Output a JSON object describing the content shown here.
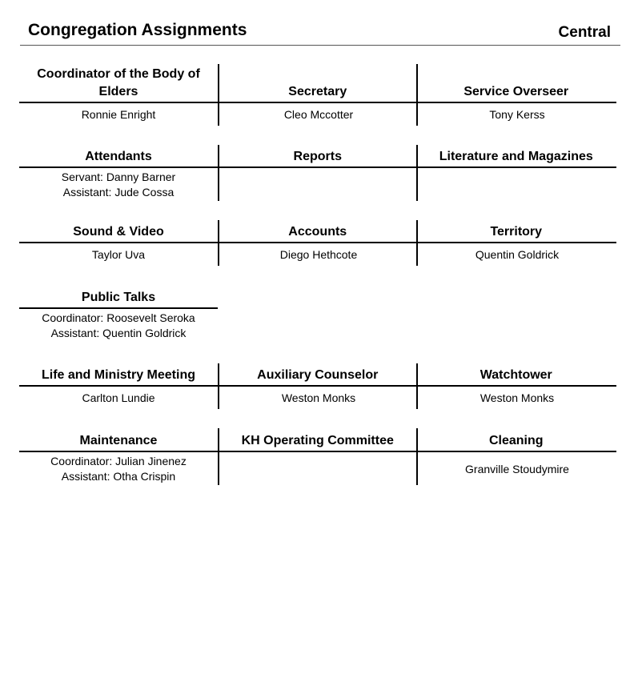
{
  "header": {
    "title": "Congregation Assignments",
    "congregation": "Central"
  },
  "sections": [
    {
      "cells": [
        {
          "title": "Coordinator of the Body of Elders",
          "lines": [
            "Ronnie Enright"
          ]
        },
        {
          "title": "Secretary",
          "lines": [
            "Cleo Mccotter"
          ]
        },
        {
          "title": "Service Overseer",
          "lines": [
            "Tony Kerss"
          ]
        }
      ]
    },
    {
      "cells": [
        {
          "title": "Attendants",
          "lines": [
            "Servant: Danny Barner",
            "Assistant: Jude Cossa"
          ]
        },
        {
          "title": "Reports",
          "lines": []
        },
        {
          "title": "Literature and Magazines",
          "lines": []
        }
      ]
    },
    {
      "cells": [
        {
          "title": "Sound & Video",
          "lines": [
            "Taylor Uva"
          ]
        },
        {
          "title": "Accounts",
          "lines": [
            "Diego Hethcote"
          ]
        },
        {
          "title": "Territory",
          "lines": [
            "Quentin Goldrick"
          ]
        }
      ]
    },
    {
      "cells": [
        {
          "title": "Public Talks",
          "lines": [
            "Coordinator: Roosevelt Seroka",
            "Assistant: Quentin Goldrick"
          ]
        }
      ]
    },
    {
      "cells": [
        {
          "title": "Life and Ministry Meeting",
          "lines": [
            "Carlton Lundie"
          ]
        },
        {
          "title": "Auxiliary Counselor",
          "lines": [
            "Weston Monks"
          ]
        },
        {
          "title": "Watchtower",
          "lines": [
            "Weston Monks"
          ]
        }
      ]
    },
    {
      "cells": [
        {
          "title": "Maintenance",
          "lines": [
            "Coordinator: Julian Jinenez",
            "Assistant: Otha Crispin"
          ]
        },
        {
          "title": "KH Operating Committee",
          "lines": []
        },
        {
          "title": "Cleaning",
          "lines": [
            "Granville Stoudymire"
          ]
        }
      ]
    }
  ]
}
